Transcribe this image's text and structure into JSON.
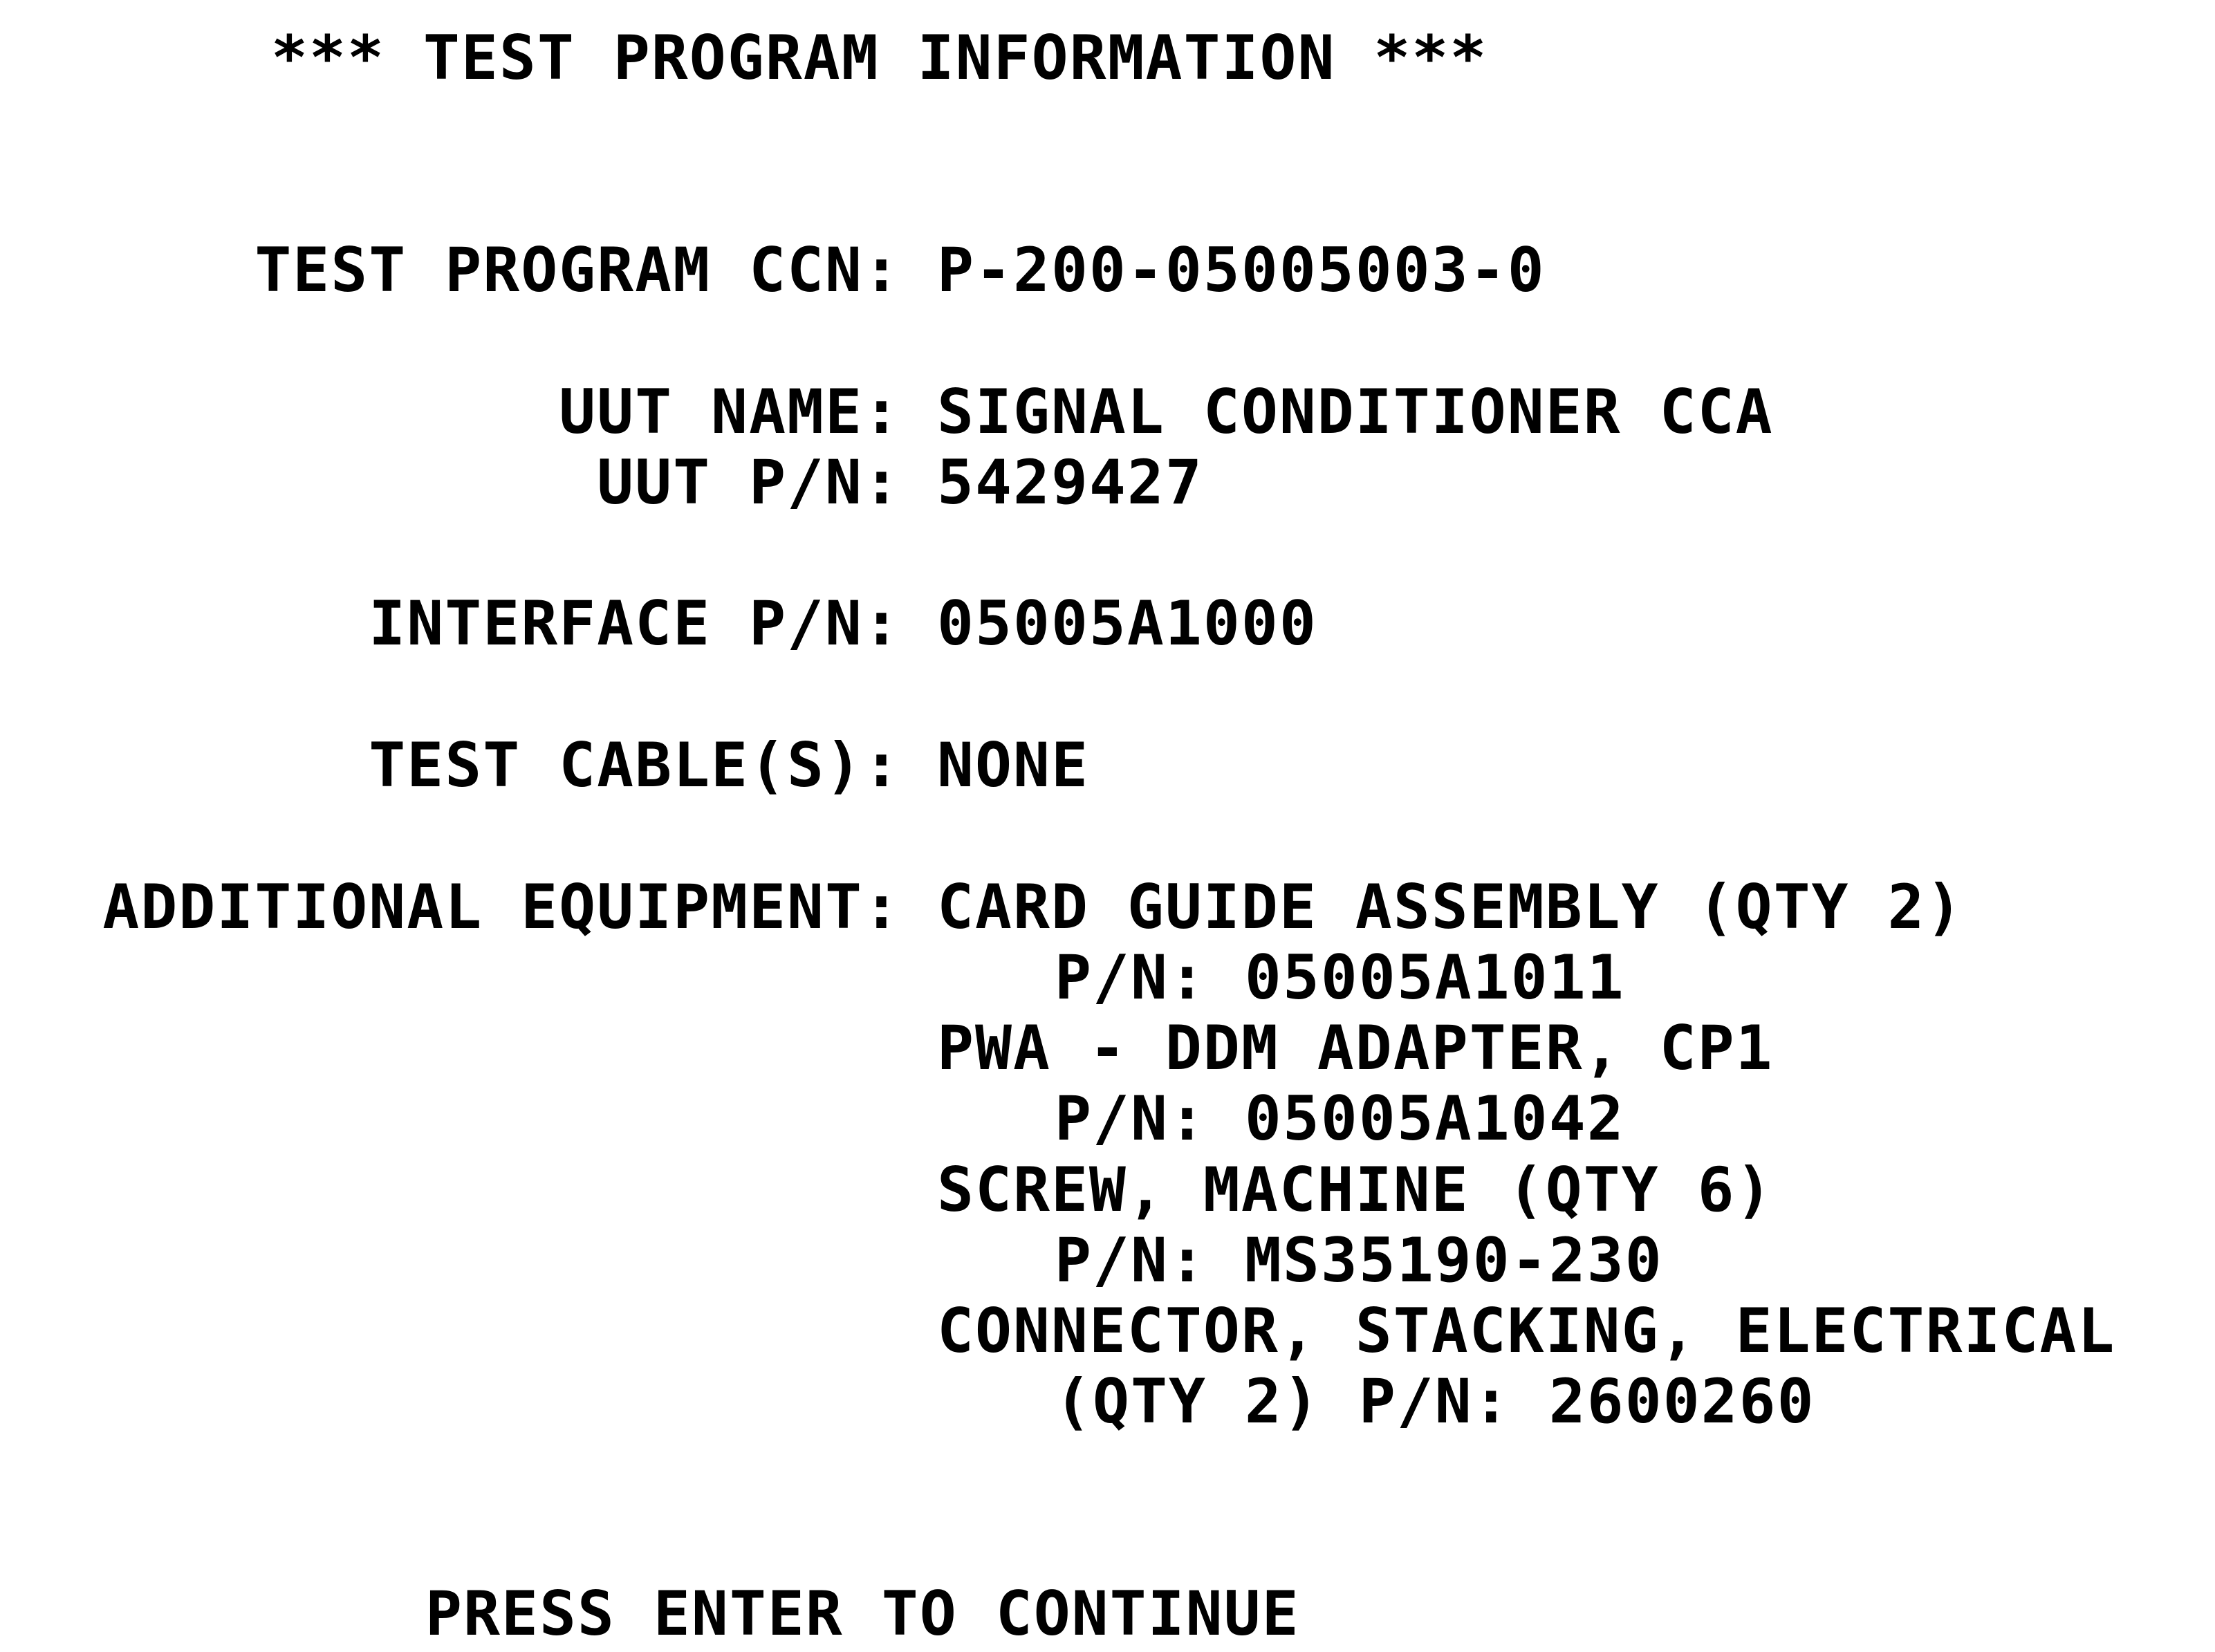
{
  "screen": {
    "title": "*** TEST PROGRAM INFORMATION ***",
    "fields": {
      "ccn_label": "TEST PROGRAM CCN:",
      "ccn_value": "P-200-05005003-0",
      "uut_name_label": "UUT NAME:",
      "uut_name_value": "SIGNAL CONDITIONER CCA",
      "uut_pn_label": "UUT P/N:",
      "uut_pn_value": "5429427",
      "interface_pn_label": "INTERFACE P/N:",
      "interface_pn_value": "05005A1000",
      "test_cables_label": "TEST CABLE(S):",
      "test_cables_value": "NONE",
      "additional_equipment_label": "ADDITIONAL EQUIPMENT:"
    },
    "equipment": [
      {
        "name": "CARD GUIDE ASSEMBLY (QTY 2)",
        "detail": "P/N: 05005A1011"
      },
      {
        "name": "PWA - DDM ADAPTER, CP1",
        "detail": "P/N: 05005A1042"
      },
      {
        "name": "SCREW, MACHINE (QTY 6)",
        "detail": "P/N: MS35190-230"
      },
      {
        "name": "CONNECTOR, STACKING, ELECTRICAL",
        "detail": "(QTY 2) P/N: 2600260"
      }
    ],
    "prompt": "PRESS ENTER TO CONTINUE"
  }
}
